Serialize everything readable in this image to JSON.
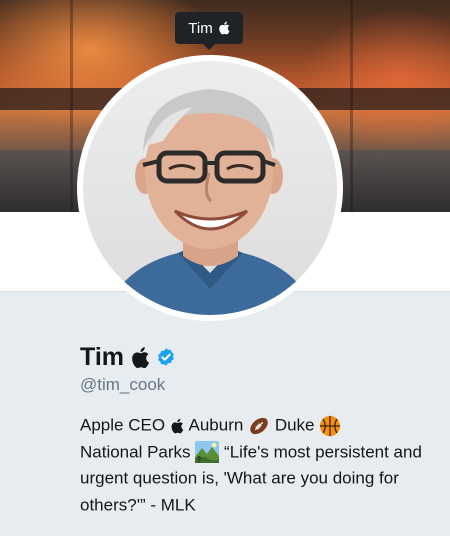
{
  "tooltip": {
    "text": "Tim",
    "icon": "apple-logo-icon"
  },
  "profile": {
    "name": "Tim",
    "name_icons": [
      "apple-logo-icon",
      "verified-badge-icon"
    ],
    "handle": "@tim_cook"
  },
  "bio": {
    "part1": "Apple CEO",
    "part2": "Auburn",
    "part3": "Duke",
    "part4": "National Parks",
    "quote": "“Life's most persistent and urgent question is, 'What are you doing for others?'” - MLK",
    "icons": [
      "apple-logo-icon",
      "football-icon",
      "basketball-icon",
      "national-park-icon"
    ]
  },
  "colors": {
    "verified": "#1da1f2",
    "text": "#14171a",
    "muted": "#657786",
    "background": "#e6ecf0"
  }
}
